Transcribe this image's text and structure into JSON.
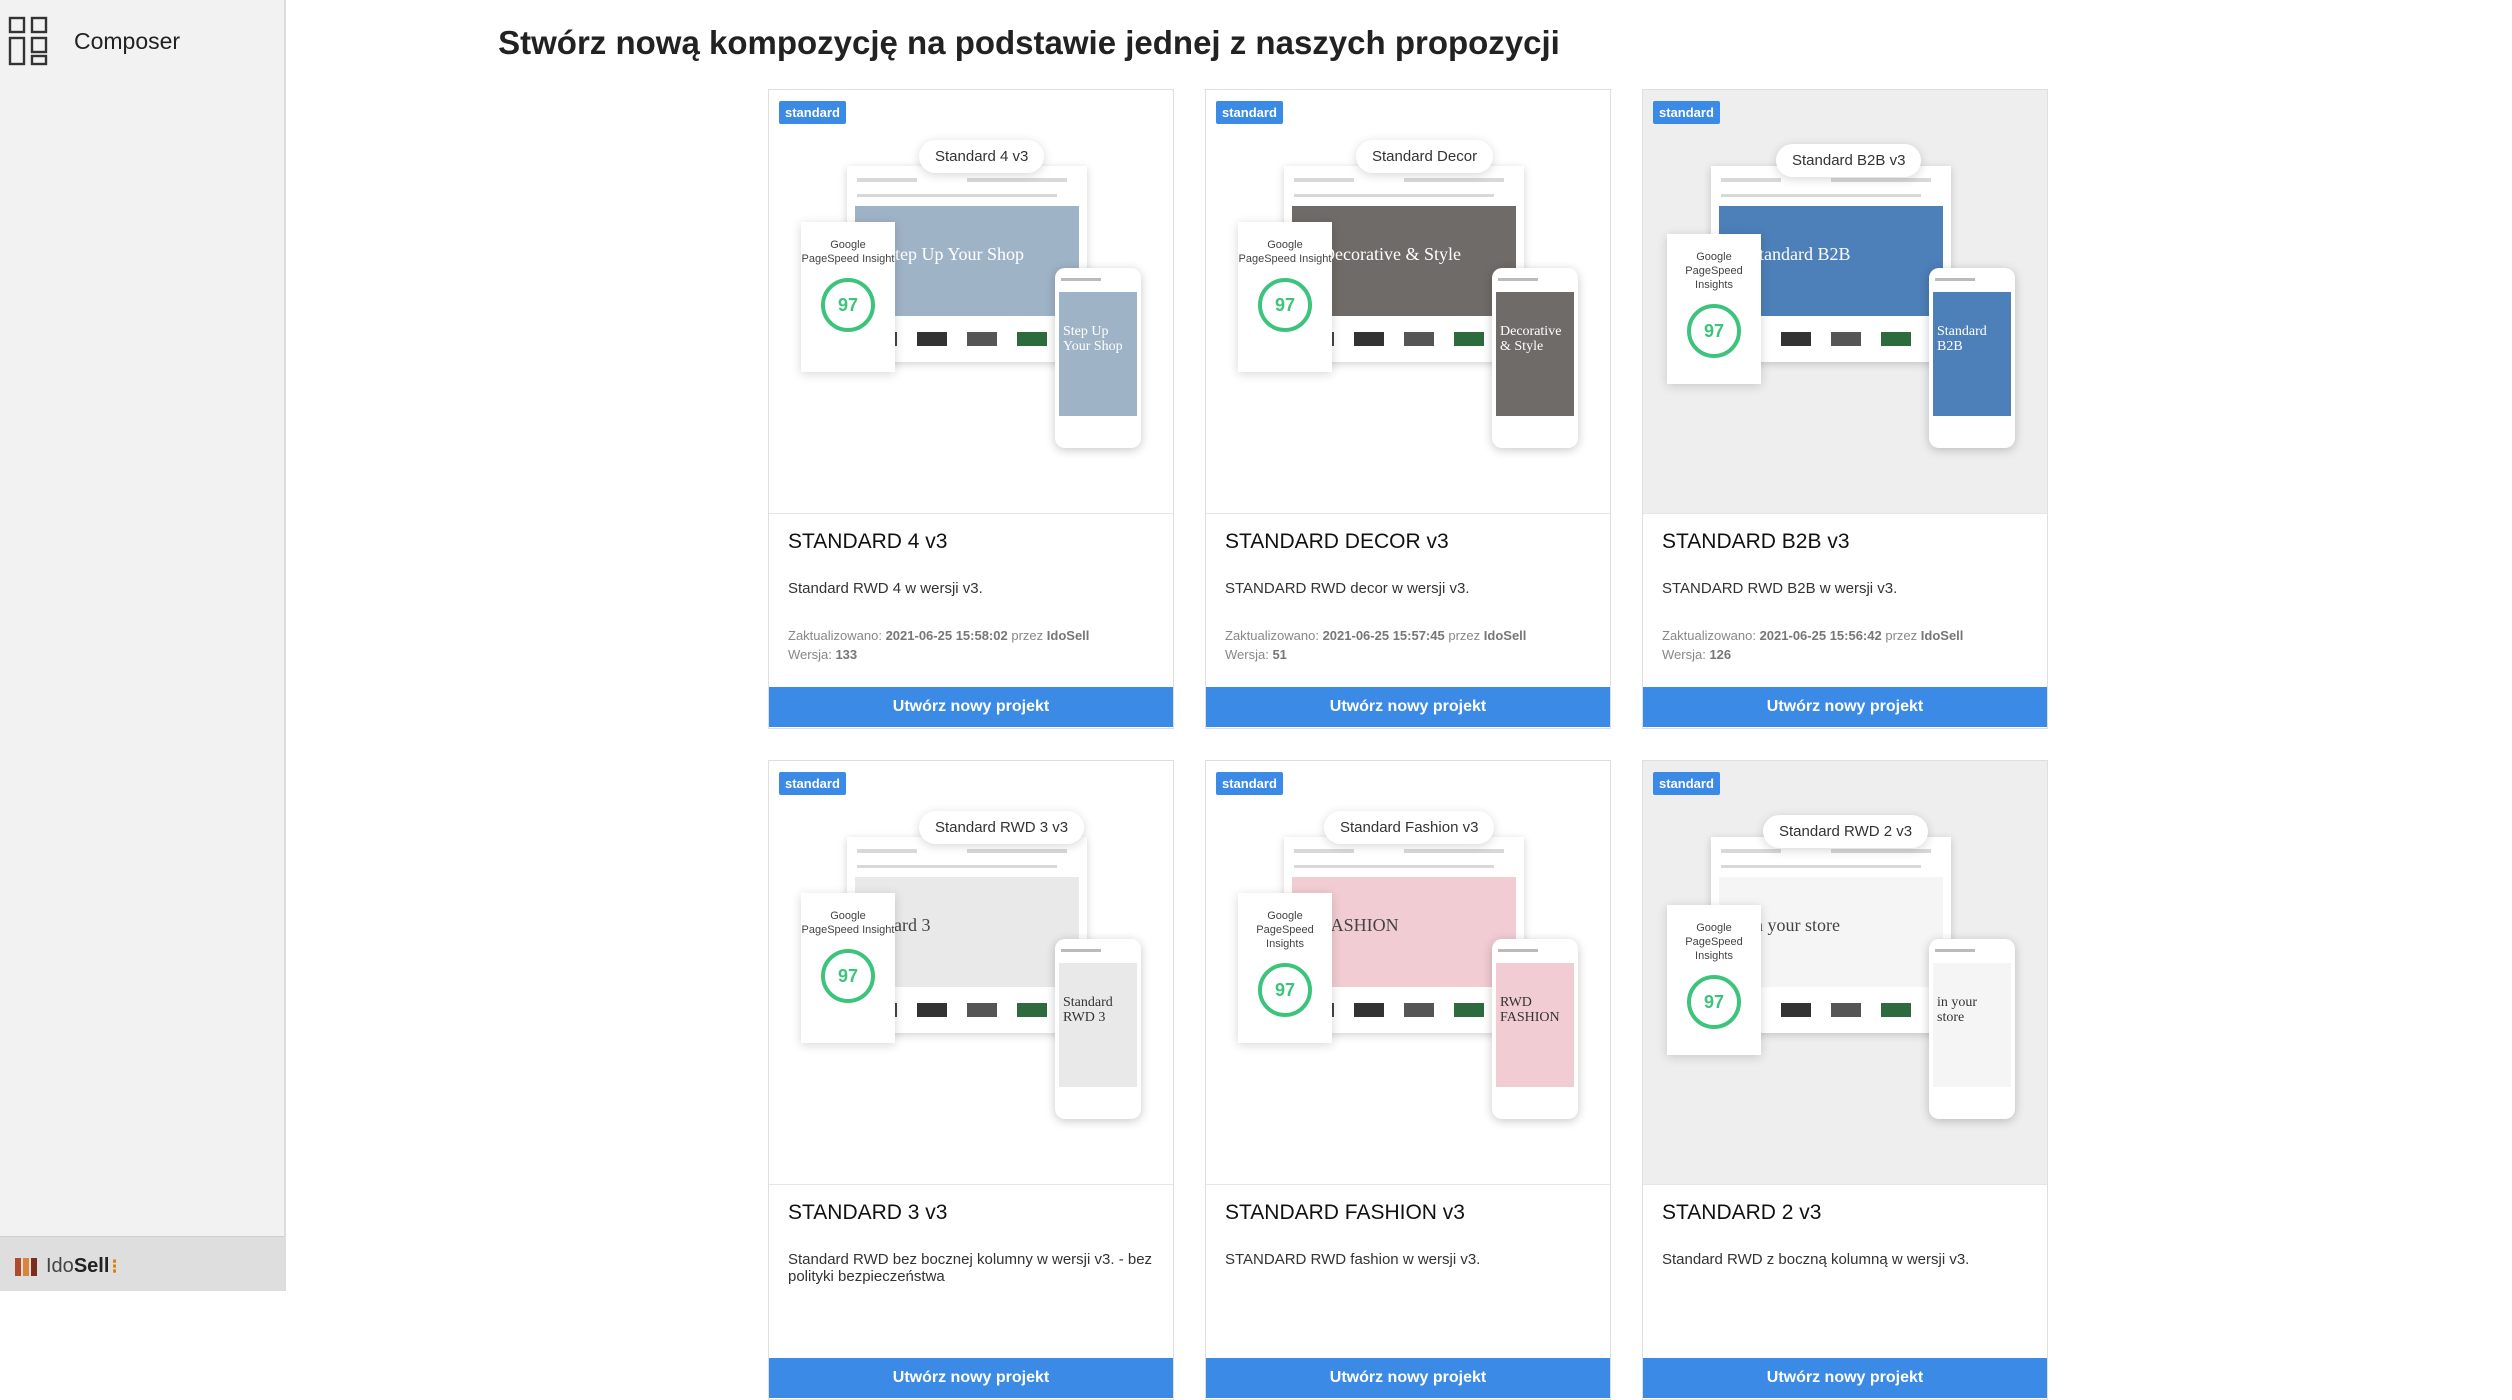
{
  "sidebar": {
    "app_name": "Composer",
    "icon": "layout-blocks-icon",
    "footer_logo": "IdoSell"
  },
  "page": {
    "title": "Stwórz nową kompozycję na podstawie jednej z naszych propozycji"
  },
  "templates": [
    {
      "badge": "standard",
      "name": "STANDARD 4 v3",
      "description": "Standard RWD 4 w wersji v3.",
      "updated_label": "Zaktualizowano:",
      "updated": "2021-06-25 15:58:02",
      "by_label": "przez",
      "author": "IdoSell",
      "version_label": "Wersja:",
      "version": "133",
      "button": "Utwórz nowy projekt",
      "preview": {
        "pill": "Standard 4 v3",
        "psi_label": "Google PageSpeed Insight",
        "score": "97",
        "hero_text": "Step Up Your Shop",
        "phone_text": "Step Up Your Shop",
        "bg": "#ffffff",
        "hero_color": "#9fb3c6"
      }
    },
    {
      "badge": "standard",
      "name": "STANDARD DECOR v3",
      "description": "STANDARD RWD decor w wersji v3.",
      "updated_label": "Zaktualizowano:",
      "updated": "2021-06-25 15:57:45",
      "by_label": "przez",
      "author": "IdoSell",
      "version_label": "Wersja:",
      "version": "51",
      "button": "Utwórz nowy projekt",
      "preview": {
        "pill": "Standard Decor",
        "psi_label": "Google PageSpeed Insight",
        "score": "97",
        "hero_text": "Decorative & Style",
        "phone_text": "Decorative & Style",
        "bg": "#ffffff",
        "hero_color": "#6f6b68"
      }
    },
    {
      "badge": "standard",
      "name": "STANDARD B2B v3",
      "description": "STANDARD RWD B2B w wersji v3.",
      "updated_label": "Zaktualizowano:",
      "updated": "2021-06-25 15:56:42",
      "by_label": "przez",
      "author": "IdoSell",
      "version_label": "Wersja:",
      "version": "126",
      "button": "Utwórz nowy projekt",
      "preview": {
        "pill": "Standard B2B v3",
        "psi_label": "Google PageSpeed Insights",
        "score": "97",
        "hero_text": "Standard B2B",
        "phone_text": "Standard B2B",
        "bg": "#eeeeee",
        "hero_color": "#4d7fb8"
      }
    },
    {
      "badge": "standard",
      "name": "STANDARD 3 v3",
      "description": "Standard RWD bez bocznej kolumny w wersji v3. - bez polityki bezpieczeństwa",
      "button": "Utwórz nowy projekt",
      "preview": {
        "pill": "Standard RWD 3 v3",
        "psi_label": "Google PageSpeed Insight",
        "score": "97",
        "hero_text": "dard 3",
        "phone_text": "Standard RWD 3",
        "bg": "#ffffff",
        "hero_color": "#e9e9e9"
      }
    },
    {
      "badge": "standard",
      "name": "STANDARD FASHION v3",
      "description": "STANDARD RWD fashion w wersji v3.",
      "button": "Utwórz nowy projekt",
      "preview": {
        "pill": "Standard Fashion  v3",
        "psi_label": "Google PageSpeed Insights",
        "score": "97",
        "hero_text": "FASHION",
        "phone_text": "RWD FASHION",
        "bg": "#ffffff",
        "hero_color": "#f1cdd3"
      }
    },
    {
      "badge": "standard",
      "name": "STANDARD 2 v3",
      "description": "Standard RWD z boczną kolumną w wersji v3.",
      "button": "Utwórz nowy projekt",
      "preview": {
        "pill": "Standard RWD 2  v3",
        "psi_label": "Google PageSpeed Insights",
        "score": "97",
        "hero_text": "in your store",
        "phone_text": "in your store",
        "bg": "#eeeeee",
        "hero_color": "#f5f5f5"
      }
    }
  ]
}
